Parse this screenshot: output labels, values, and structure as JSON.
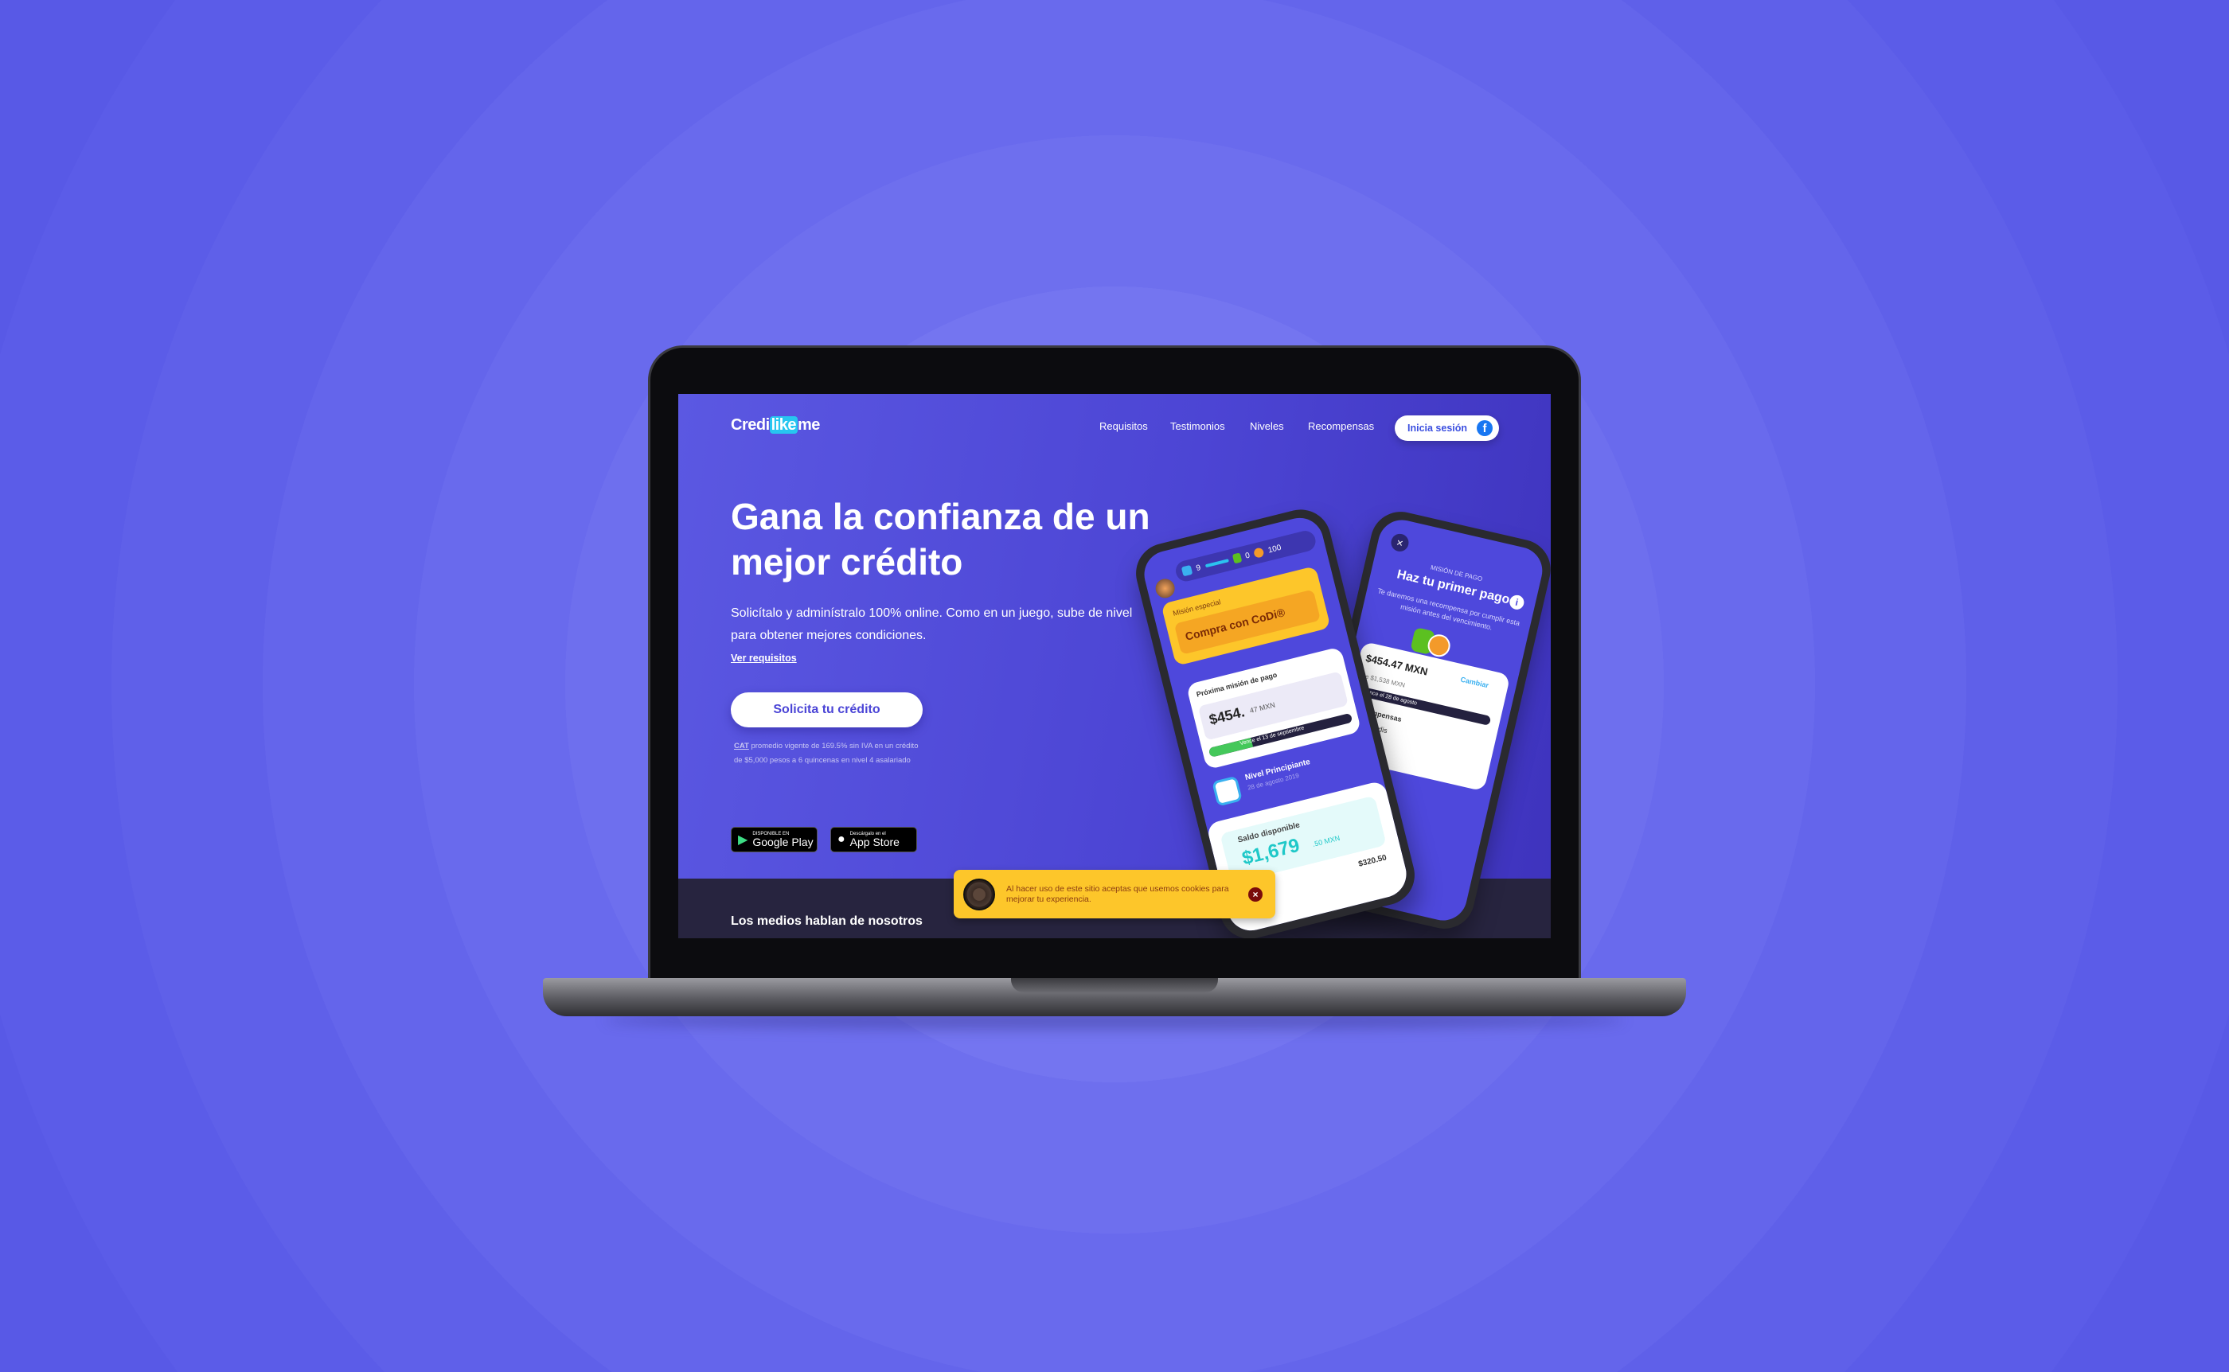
{
  "colors": {
    "background": "#5b5ce8",
    "accent": "#4b45d6",
    "cookie_banner": "#fdc62a",
    "facebook": "#1877f2"
  },
  "header": {
    "logo": {
      "part1": "Credi",
      "part2": "like",
      "part3": "me"
    },
    "nav": [
      {
        "label": "Requisitos"
      },
      {
        "label": "Testimonios"
      },
      {
        "label": "Niveles"
      },
      {
        "label": "Recompensas"
      }
    ],
    "login_label": "Inicia sesión",
    "login_icon": "facebook-icon"
  },
  "hero": {
    "title": "Gana la confianza de un mejor crédito",
    "subtitle": "Solicítalo y adminístralo 100% online. Como en un juego, sube de nivel para obtener mejores condiciones.",
    "link": "Ver requisitos",
    "cta": "Solicita tu crédito",
    "cat_label": "CAT",
    "cat_text_1": " promedio vigente de 169.5% sin IVA en un crédito",
    "cat_text_2": "de $5,000 pesos a 6 quincenas en nivel 4 asalariado",
    "google_play": {
      "small": "DISPONIBLE EN",
      "large": "Google Play"
    },
    "app_store": {
      "small": "Descárgalo en el",
      "large": "App Store"
    }
  },
  "media_heading": "Los medios hablan de nosotros",
  "cookie": {
    "text": "Al hacer uso de este sitio aceptas que usemos cookies para mejorar tu experiencia.",
    "close": "×"
  },
  "phone_left": {
    "gems_blue": "9",
    "gems_green": "0",
    "coins": "100",
    "special_label": "Misión especial",
    "special_title": "Compra con CoDi®",
    "next_label": "Próxima misión de pago",
    "amount": "$454.",
    "amount_cents": "47 MXN",
    "due": "Vence el 13 de septiembre",
    "level": "Nivel Principiante",
    "level_date": "28 de agosto 2019",
    "balance_label": "Saldo disponible",
    "balance": "$1,679",
    "balance_cents": ".50 MXN",
    "used_amount": "$320.50",
    "used_label": "utilizado"
  },
  "phone_right": {
    "close": "×",
    "kicker": "MISIÓN DE PAGO",
    "title": "Haz tu primer pago",
    "info": "i",
    "desc": "Te daremos una recompensa por cumplir esta misión antes del vencimiento.",
    "amount": "$454.47 MXN",
    "change": "Cambiar",
    "total": "de $1,538 MXN",
    "due": "Vence el 28 de agosto",
    "rewards": "Recompensas",
    "reward_value": "+300 credis"
  }
}
